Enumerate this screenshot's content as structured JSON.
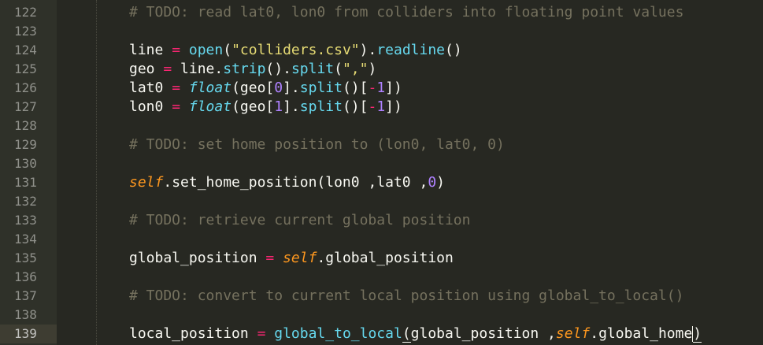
{
  "lines": [
    {
      "num": "122",
      "t": [
        [
          "comment",
          "# TODO: read lat0, lon0 from colliders into floating point values"
        ]
      ]
    },
    {
      "num": "123",
      "t": []
    },
    {
      "num": "124",
      "t": [
        [
          "plain",
          "line "
        ],
        [
          "op",
          "="
        ],
        [
          "plain",
          " "
        ],
        [
          "keyword",
          "open"
        ],
        [
          "plain",
          "("
        ],
        [
          "string",
          "\"colliders.csv\""
        ],
        [
          "plain",
          ")."
        ],
        [
          "keyword",
          "readline"
        ],
        [
          "plain",
          "()"
        ]
      ]
    },
    {
      "num": "125",
      "t": [
        [
          "plain",
          "geo "
        ],
        [
          "op",
          "="
        ],
        [
          "plain",
          " line."
        ],
        [
          "keyword",
          "strip"
        ],
        [
          "plain",
          "()."
        ],
        [
          "keyword",
          "split"
        ],
        [
          "plain",
          "("
        ],
        [
          "string",
          "\",\""
        ],
        [
          "plain",
          ")"
        ]
      ]
    },
    {
      "num": "126",
      "t": [
        [
          "plain",
          "lat0 "
        ],
        [
          "op",
          "="
        ],
        [
          "plain",
          " "
        ],
        [
          "builtin",
          "float"
        ],
        [
          "plain",
          "(geo["
        ],
        [
          "number",
          "0"
        ],
        [
          "plain",
          "]."
        ],
        [
          "keyword",
          "split"
        ],
        [
          "plain",
          "()["
        ],
        [
          "op",
          "-"
        ],
        [
          "number",
          "1"
        ],
        [
          "plain",
          "])"
        ]
      ]
    },
    {
      "num": "127",
      "t": [
        [
          "plain",
          "lon0 "
        ],
        [
          "op",
          "="
        ],
        [
          "plain",
          " "
        ],
        [
          "builtin",
          "float"
        ],
        [
          "plain",
          "(geo["
        ],
        [
          "number",
          "1"
        ],
        [
          "plain",
          "]."
        ],
        [
          "keyword",
          "split"
        ],
        [
          "plain",
          "()["
        ],
        [
          "op",
          "-"
        ],
        [
          "number",
          "1"
        ],
        [
          "plain",
          "])"
        ]
      ]
    },
    {
      "num": "128",
      "t": []
    },
    {
      "num": "129",
      "t": [
        [
          "comment",
          "# TODO: set home position to (lon0, lat0, 0)"
        ]
      ]
    },
    {
      "num": "130",
      "t": []
    },
    {
      "num": "131",
      "t": [
        [
          "self",
          "self"
        ],
        [
          "plain",
          ".set_home_position(lon0 ,lat0 ,"
        ],
        [
          "number",
          "0"
        ],
        [
          "plain",
          ")"
        ]
      ]
    },
    {
      "num": "132",
      "t": []
    },
    {
      "num": "133",
      "t": [
        [
          "comment",
          "# TODO: retrieve current global position"
        ]
      ]
    },
    {
      "num": "134",
      "t": []
    },
    {
      "num": "135",
      "t": [
        [
          "plain",
          "global_position "
        ],
        [
          "op",
          "="
        ],
        [
          "plain",
          " "
        ],
        [
          "self",
          "self"
        ],
        [
          "plain",
          ".global_position"
        ]
      ]
    },
    {
      "num": "136",
      "t": []
    },
    {
      "num": "137",
      "t": [
        [
          "comment",
          "# TODO: convert to current local position using global_to_local()"
        ]
      ]
    },
    {
      "num": "138",
      "t": []
    },
    {
      "num": "139",
      "t": [
        [
          "plain",
          "local_position "
        ],
        [
          "op",
          "="
        ],
        [
          "plain",
          " "
        ],
        [
          "keyword",
          "global_to_local"
        ],
        [
          "match",
          "("
        ],
        [
          "plain",
          "global_position ,"
        ],
        [
          "self",
          "self"
        ],
        [
          "plain",
          ".global_home"
        ],
        [
          "cursor",
          ""
        ],
        [
          "match",
          ")"
        ]
      ]
    }
  ],
  "current_line": "139",
  "colors": {
    "background": "#272822",
    "gutter": "#2f3129",
    "comment": "#75715e",
    "keyword": "#66d9ef",
    "operator": "#f92672",
    "string": "#e6db74",
    "number": "#ae81ff",
    "self": "#fd971f"
  }
}
